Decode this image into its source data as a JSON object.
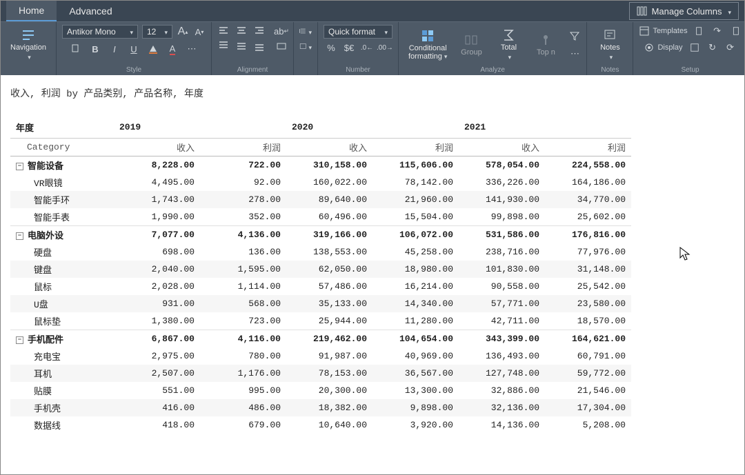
{
  "tabs": {
    "home": "Home",
    "advanced": "Advanced"
  },
  "manage_columns": "Manage Columns",
  "ribbon": {
    "navigation": "Navigation",
    "font_name": "Antikor Mono",
    "font_size": "12",
    "quick_format": "Quick format",
    "cond_fmt_1": "Conditional",
    "cond_fmt_2": "formatting",
    "group": "Group",
    "total": "Total",
    "top_n": "Top n",
    "notes": "Notes",
    "templates": "Templates",
    "display": "Display",
    "grp_style": "Style",
    "grp_align": "Alignment",
    "grp_number": "Number",
    "grp_analyze": "Analyze",
    "grp_notes": "Notes",
    "grp_setup": "Setup"
  },
  "title": "收入, 利润 by 产品类别, 产品名称, 年度",
  "header": {
    "year": "年度",
    "category": "Category",
    "rev": "收入",
    "profit": "利润"
  },
  "years": [
    "2019",
    "2020",
    "2021"
  ],
  "groups": [
    {
      "name": "智能设备",
      "totals": [
        "8,228.00",
        "722.00",
        "310,158.00",
        "115,606.00",
        "578,054.00",
        "224,558.00"
      ],
      "rows": [
        {
          "name": "VR眼镜",
          "v": [
            "4,495.00",
            "92.00",
            "160,022.00",
            "78,142.00",
            "336,226.00",
            "164,186.00"
          ]
        },
        {
          "name": "智能手环",
          "v": [
            "1,743.00",
            "278.00",
            "89,640.00",
            "21,960.00",
            "141,930.00",
            "34,770.00"
          ]
        },
        {
          "name": "智能手表",
          "v": [
            "1,990.00",
            "352.00",
            "60,496.00",
            "15,504.00",
            "99,898.00",
            "25,602.00"
          ]
        }
      ]
    },
    {
      "name": "电脑外设",
      "totals": [
        "7,077.00",
        "4,136.00",
        "319,166.00",
        "106,072.00",
        "531,586.00",
        "176,816.00"
      ],
      "rows": [
        {
          "name": "硬盘",
          "v": [
            "698.00",
            "136.00",
            "138,553.00",
            "45,258.00",
            "238,716.00",
            "77,976.00"
          ]
        },
        {
          "name": "键盘",
          "v": [
            "2,040.00",
            "1,595.00",
            "62,050.00",
            "18,980.00",
            "101,830.00",
            "31,148.00"
          ]
        },
        {
          "name": "鼠标",
          "v": [
            "2,028.00",
            "1,114.00",
            "57,486.00",
            "16,214.00",
            "90,558.00",
            "25,542.00"
          ]
        },
        {
          "name": "U盘",
          "v": [
            "931.00",
            "568.00",
            "35,133.00",
            "14,340.00",
            "57,771.00",
            "23,580.00"
          ]
        },
        {
          "name": "鼠标垫",
          "v": [
            "1,380.00",
            "723.00",
            "25,944.00",
            "11,280.00",
            "42,711.00",
            "18,570.00"
          ]
        }
      ]
    },
    {
      "name": "手机配件",
      "totals": [
        "6,867.00",
        "4,116.00",
        "219,462.00",
        "104,654.00",
        "343,399.00",
        "164,621.00"
      ],
      "rows": [
        {
          "name": "充电宝",
          "v": [
            "2,975.00",
            "780.00",
            "91,987.00",
            "40,969.00",
            "136,493.00",
            "60,791.00"
          ]
        },
        {
          "name": "耳机",
          "v": [
            "2,507.00",
            "1,176.00",
            "78,153.00",
            "36,567.00",
            "127,748.00",
            "59,772.00"
          ]
        },
        {
          "name": "贴膜",
          "v": [
            "551.00",
            "995.00",
            "20,300.00",
            "13,300.00",
            "32,886.00",
            "21,546.00"
          ]
        },
        {
          "name": "手机壳",
          "v": [
            "416.00",
            "486.00",
            "18,382.00",
            "9,898.00",
            "32,136.00",
            "17,304.00"
          ]
        },
        {
          "name": "数据线",
          "v": [
            "418.00",
            "679.00",
            "10,640.00",
            "3,920.00",
            "14,136.00",
            "5,208.00"
          ]
        }
      ]
    }
  ]
}
